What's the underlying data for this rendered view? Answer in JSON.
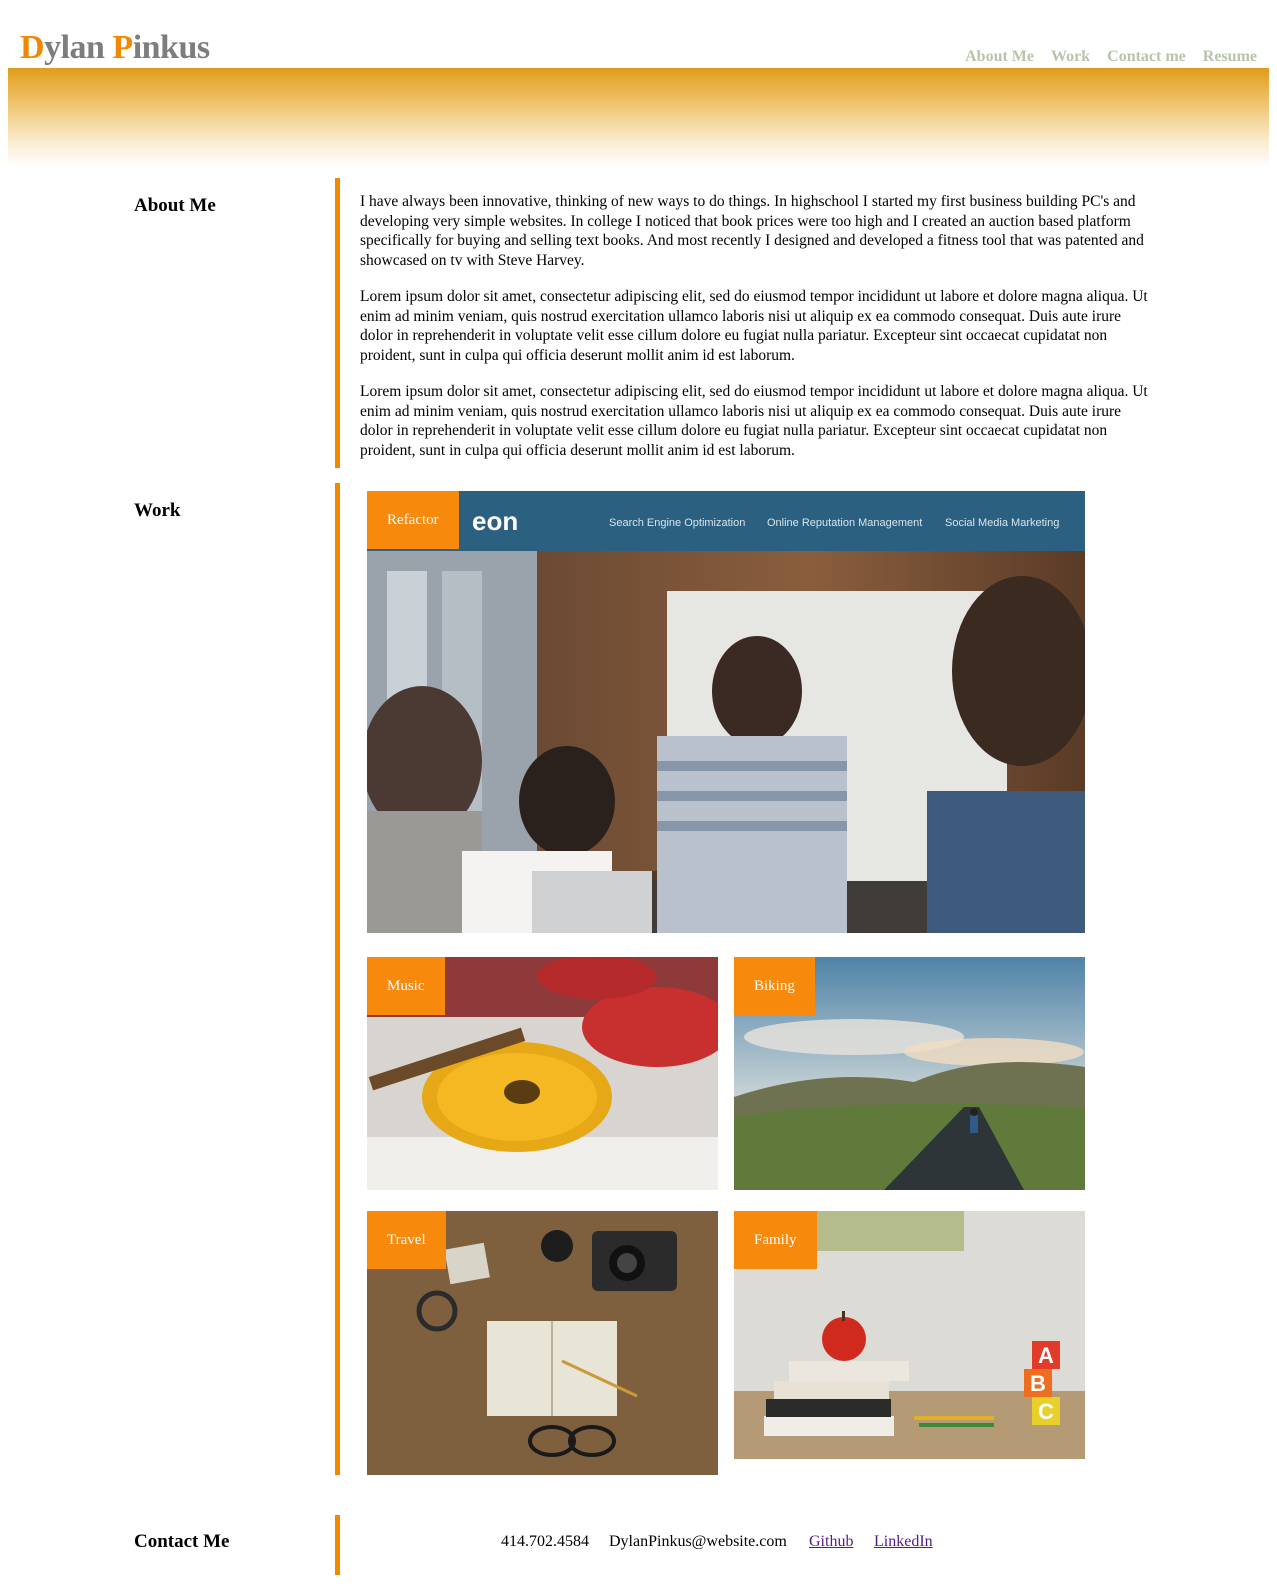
{
  "header": {
    "brand_first_initial": "D",
    "brand_first_rest": "ylan ",
    "brand_last_initial": "P",
    "brand_last_rest": "inkus",
    "nav": [
      "About Me",
      "Work",
      "Contact me",
      "Resume"
    ]
  },
  "about": {
    "label": "About Me",
    "paragraphs": [
      "I have always been innovative, thinking of new ways to do things. In highschool I started my first business building PC's and developing very simple websites. In college I noticed that book prices were too high and I created an auction based platform specifically for buying and selling text books. And most recently I designed and developed a fitness tool that was patented and showcased on tv with Steve Harvey.",
      "Lorem ipsum dolor sit amet, consectetur adipiscing elit, sed do eiusmod tempor incididunt ut labore et dolore magna aliqua. Ut enim ad minim veniam, quis nostrud exercitation ullamco laboris nisi ut aliquip ex ea commodo consequat. Duis aute irure dolor in reprehenderit in voluptate velit esse cillum dolore eu fugiat nulla pariatur. Excepteur sint occaecat cupidatat non proident, sunt in culpa qui officia deserunt mollit anim id est laborum.",
      "Lorem ipsum dolor sit amet, consectetur adipiscing elit, sed do eiusmod tempor incididunt ut labore et dolore magna aliqua. Ut enim ad minim veniam, quis nostrud exercitation ullamco laboris nisi ut aliquip ex ea commodo consequat. Duis aute irure dolor in reprehenderit in voluptate velit esse cillum dolore eu fugiat nulla pariatur. Excepteur sint occaecat cupidatat non proident, sunt in culpa qui officia deserunt mollit anim id est laborum."
    ]
  },
  "work": {
    "label": "Work",
    "featured": {
      "tag": "Refactor",
      "site_logo_fragment": "eon",
      "site_nav": [
        "Search Engine Optimization",
        "Online Reputation Management",
        "Social Media Marketing"
      ]
    },
    "tiles": [
      {
        "tag": "Music",
        "image": "ukuleles-photo"
      },
      {
        "tag": "Biking",
        "image": "cyclist-road-photo"
      },
      {
        "tag": "Travel",
        "image": "map-camera-notebook-photo"
      },
      {
        "tag": "Family",
        "image": "apple-books-blocks-photo",
        "blocks": [
          "A",
          "B",
          "C"
        ]
      }
    ]
  },
  "contact": {
    "label": "Contact Me",
    "phone": "414.702.4584",
    "email": "DylanPinkus@website.com",
    "github": "Github",
    "linkedin": "LinkedIn"
  },
  "colors": {
    "accent": "#f08800",
    "tag_bg": "#f7890c",
    "nav": "#b7c4a9",
    "brand_gray": "#7d7d7d"
  }
}
